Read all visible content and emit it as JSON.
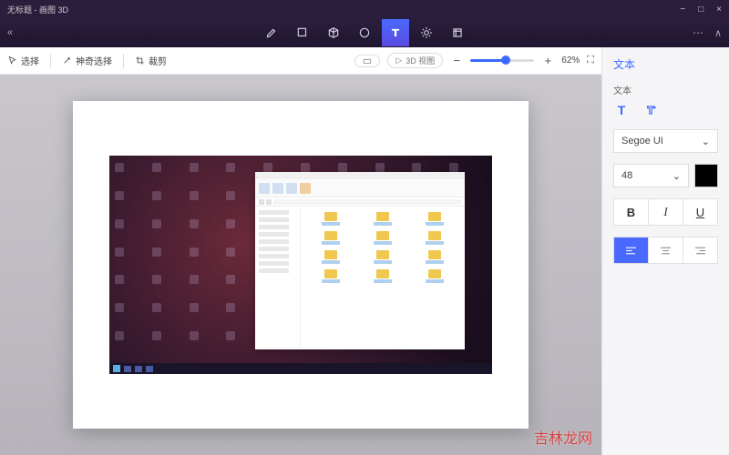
{
  "window": {
    "title": "无标题 - 画图 3D",
    "min": "−",
    "max": "□",
    "close": "×"
  },
  "toolbar": {
    "expand": "«",
    "collapse": "∧",
    "more": "⋯"
  },
  "subtoolbar": {
    "select": "选择",
    "magic_select": "神奇选择",
    "crop": "裁剪",
    "view3d_label": "3D 视图",
    "play": "▷",
    "zoom_pct": "62%"
  },
  "panel": {
    "title": "文本",
    "section_label": "文本",
    "font": "Segoe UI",
    "size": "48",
    "bold": "B",
    "italic": "I",
    "underline": "U",
    "chevron": "⌄"
  },
  "watermark": "吉林龙网"
}
